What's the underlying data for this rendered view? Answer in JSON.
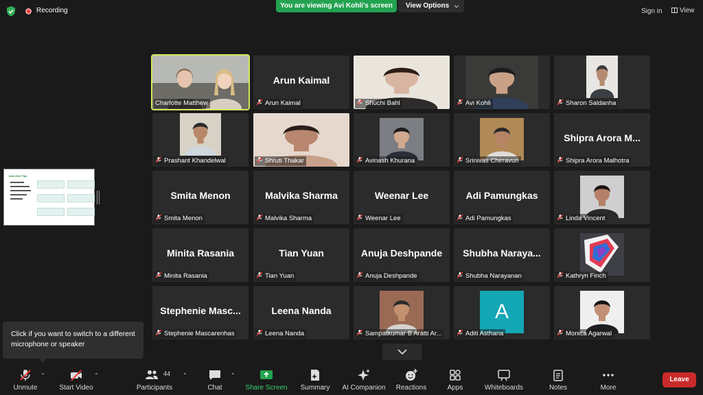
{
  "top_bar": {
    "recording_label": "Recording",
    "viewing_banner": "You are viewing Avi Kohli's screen",
    "view_options_label": "View Options",
    "sign_in_label": "Sign in",
    "view_label": "View"
  },
  "colors": {
    "banner_green": "#23a350",
    "active_speaker_border": "#d4e85a",
    "leave_red": "#c92a2a",
    "share_green": "#3ad16f",
    "avatar_teal": "#14a7b5"
  },
  "participants": [
    {
      "name": "Charlotte Matthew",
      "video": true,
      "active": true
    },
    {
      "name": "Arun Kaimal",
      "display": "Arun Kaimal",
      "video": false
    },
    {
      "name": "Shuchi Bahl",
      "video": true
    },
    {
      "name": "Avi Kohli",
      "video": true
    },
    {
      "name": "Sharon Saldanha",
      "video": true
    },
    {
      "name": "Prashant Khandelwal",
      "video": true
    },
    {
      "name": "Shruti Thakar",
      "video": true
    },
    {
      "name": "Avinash Khurana",
      "video": true
    },
    {
      "name": "Srinivas Chirravuri",
      "video": true
    },
    {
      "name": "Shipra Arora Malhotra",
      "display": "Shipra Arora M...",
      "video": false
    },
    {
      "name": "Smita Menon",
      "display": "Smita Menon",
      "video": false
    },
    {
      "name": "Malvika Sharma",
      "display": "Malvika Sharma",
      "video": false
    },
    {
      "name": "Weenar Lee",
      "display": "Weenar Lee",
      "video": false
    },
    {
      "name": "Adi Pamungkas",
      "display": "Adi Pamungkas",
      "video": false
    },
    {
      "name": "Linda Vincent",
      "video": true
    },
    {
      "name": "Minita Rasania",
      "display": "Minita Rasania",
      "video": false
    },
    {
      "name": "Tian Yuan",
      "display": "Tian Yuan",
      "video": false
    },
    {
      "name": "Anuja Deshpande",
      "display": "Anuja Deshpande",
      "video": false
    },
    {
      "name": "Shubha Narayanan",
      "display": "Shubha  Naraya...",
      "video": false
    },
    {
      "name": "Kathryn Finch",
      "video": true
    },
    {
      "name": "Stephenie Mascarenhas",
      "display": "Stephenie  Masc...",
      "video": false
    },
    {
      "name": "Leena Nanda",
      "display": "Leena Nanda",
      "video": false
    },
    {
      "name": "Sampatkumar B Aratti Ar...",
      "video": true
    },
    {
      "name": "Aditi Asthana",
      "avatar_letter": "A",
      "video": false
    },
    {
      "name": "Monica Agarwal",
      "video": true
    }
  ],
  "shared_screen": {
    "title": "Interview Tips",
    "icon": "slide-thumbnail"
  },
  "tooltip": {
    "text": "Click if you want to switch to a different microphone or speaker"
  },
  "toolbar": {
    "unmute": "Unmute",
    "start_video": "Start Video",
    "participants": "Participants",
    "participants_count": "44",
    "chat": "Chat",
    "share_screen": "Share Screen",
    "summary": "Summary",
    "ai_companion": "AI Companion",
    "reactions": "Reactions",
    "apps": "Apps",
    "whiteboards": "Whiteboards",
    "notes": "Notes",
    "more": "More",
    "leave": "Leave"
  }
}
